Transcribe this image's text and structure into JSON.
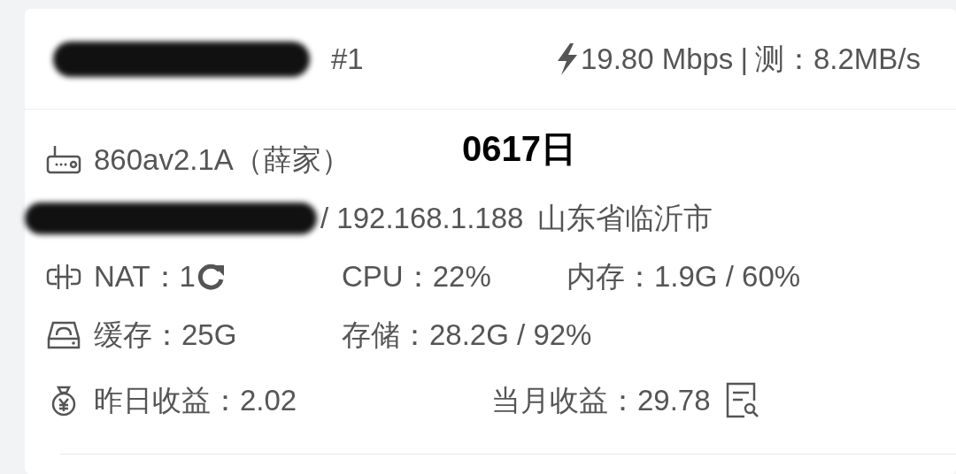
{
  "header": {
    "rank": "#1",
    "speed": "19.80 Mbps",
    "separator": "|",
    "measured": "测：8.2MB/s"
  },
  "overlay_label": "0617日",
  "device": {
    "name": "860av2.1A（薛家）"
  },
  "network": {
    "address": "/ 192.168.1.188",
    "location": "山东省临沂市"
  },
  "nat": {
    "label": "NAT：1"
  },
  "cpu": "CPU：22%",
  "memory": "内存：1.9G / 60%",
  "cache": "缓存：25G",
  "storage": "存储：28.2G / 92%",
  "earnings": {
    "yesterday": "昨日收益：2.02",
    "month": "当月收益：29.78"
  }
}
